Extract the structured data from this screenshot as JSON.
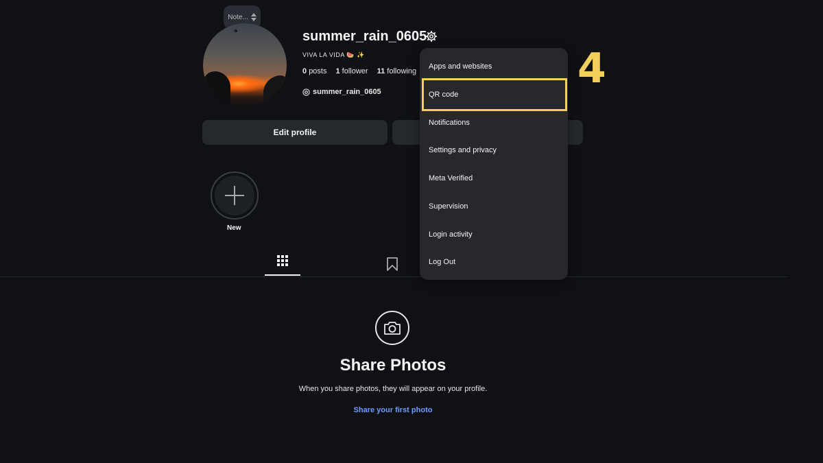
{
  "note": {
    "label": "Note..."
  },
  "profile": {
    "username": "summer_rain_0605",
    "bio": "VIVA LA VIDA 🍉 ✨",
    "posts_count": "0",
    "posts_label": "posts",
    "followers_count": "1",
    "followers_label": "follower",
    "following_count": "11",
    "following_label": "following",
    "threads_handle": "summer_rain_0605"
  },
  "buttons": {
    "edit_profile": "Edit profile"
  },
  "highlights": {
    "new_label": "New"
  },
  "menu": {
    "items": [
      "Apps and websites",
      "QR code",
      "Notifications",
      "Settings and privacy",
      "Meta Verified",
      "Supervision",
      "Login activity",
      "Log Out"
    ]
  },
  "annotation": {
    "step_number": "4",
    "color": "#f2d05b"
  },
  "empty_state": {
    "title": "Share Photos",
    "subtitle": "When you share photos, they will appear on your profile.",
    "link": "Share your first photo"
  },
  "colors": {
    "background": "#0f1115",
    "menu_background": "#26282d",
    "button_background": "#25282d",
    "link": "#6d9cff"
  },
  "icons": [
    "gear-icon",
    "threads-icon",
    "plus-icon",
    "grid-icon",
    "bookmark-icon",
    "camera-icon"
  ]
}
